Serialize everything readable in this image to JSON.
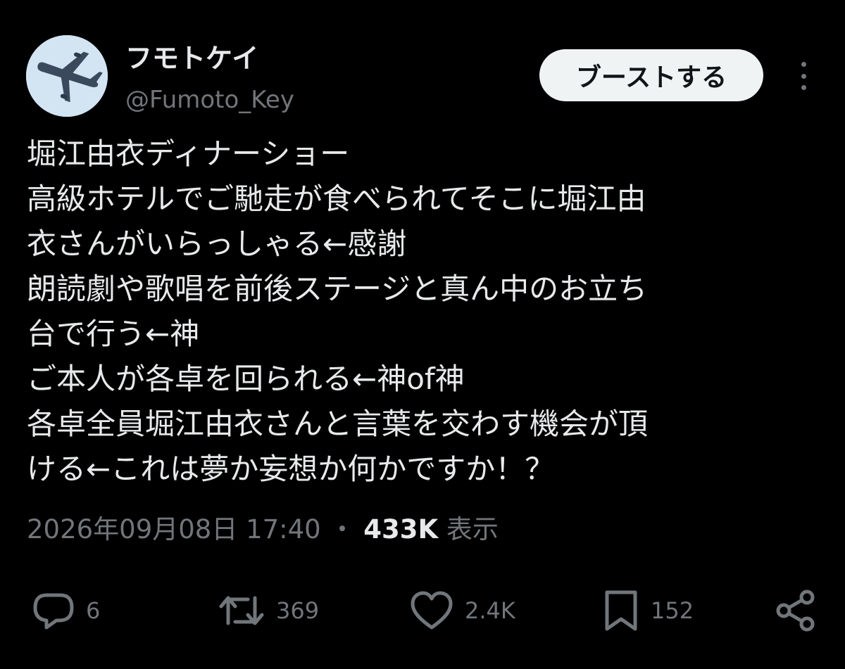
{
  "author": {
    "display_name": "フモトケイ",
    "handle": "@Fumoto_Key",
    "avatar_icon": "airplane-avatar"
  },
  "header": {
    "boost_label": "ブーストする",
    "more_icon": "more-vertical-icon"
  },
  "tweet": {
    "lines": [
      "堀江由衣ディナーショー",
      "高級ホテルでご馳走が食べられてそこに堀江由",
      "衣さんがいらっしゃる←感謝",
      "朗読劇や歌唱を前後ステージと真ん中のお立ち",
      "台で行う←神",
      "ご本人が各卓を回られる←神of神",
      "各卓全員堀江由衣さんと言葉を交わす機会が頂",
      "ける←これは夢か妄想か何かですか！？"
    ]
  },
  "meta": {
    "timestamp": "2026年09月08日 17:40",
    "separator": "・",
    "views_count": "433K",
    "views_label": "表示"
  },
  "actions": {
    "reply_count": "6",
    "boost_count": "369",
    "like_count": "2.4K",
    "bookmark_count": "152"
  },
  "colors": {
    "background": "#000000",
    "text_primary": "#e7e9ea",
    "text_secondary": "#71767b",
    "button_bg": "#eff3f4"
  }
}
